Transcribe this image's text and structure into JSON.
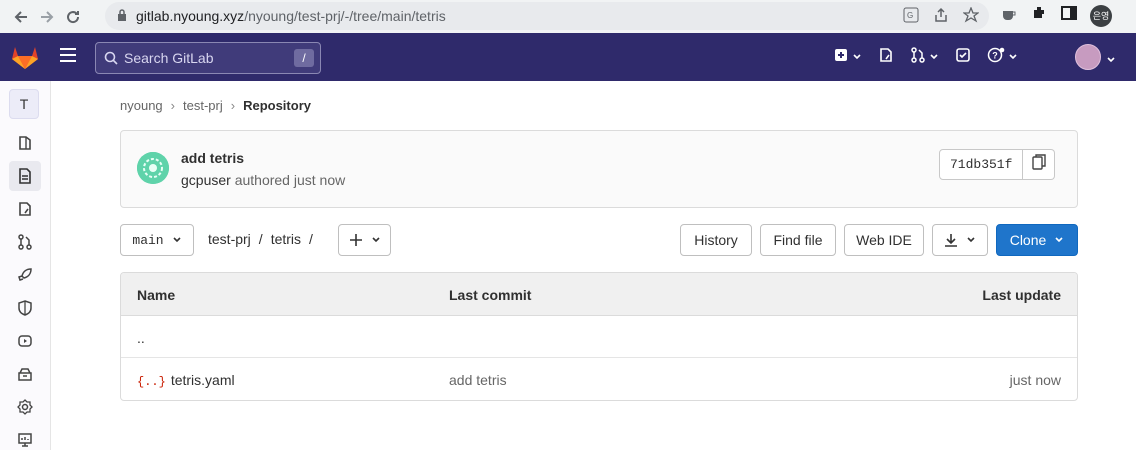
{
  "browser": {
    "url_host": "gitlab.nyoung.xyz",
    "url_path": "/nyoung/test-prj/-/tree/main/tetris",
    "profile_label": "은영"
  },
  "header": {
    "search_placeholder": "Search GitLab",
    "search_shortcut": "/"
  },
  "sidebar": {
    "project_initial": "T",
    "items": [
      "project-overview-icon",
      "repository-icon",
      "issues-icon",
      "merge-requests-icon",
      "deployments-icon",
      "security-icon",
      "pipelines-icon",
      "packages-icon",
      "settings-icon",
      "monitor-icon"
    ]
  },
  "breadcrumb": {
    "items": [
      "nyoung",
      "test-prj"
    ],
    "current": "Repository"
  },
  "commit": {
    "title": "add tetris",
    "author": "gcpuser",
    "meta_suffix": "authored just now",
    "sha": "71db351f"
  },
  "toolbar": {
    "branch": "main",
    "path": [
      "test-prj",
      "tetris"
    ],
    "history": "History",
    "find_file": "Find file",
    "web_ide": "Web IDE",
    "clone": "Clone"
  },
  "tree": {
    "headers": {
      "name": "Name",
      "last_commit": "Last commit",
      "last_update": "Last update"
    },
    "parent": "..",
    "rows": [
      {
        "name": "tetris.yaml",
        "commit": "add tetris",
        "updated": "just now"
      }
    ]
  },
  "colors": {
    "header": "#2f2a6b",
    "primary": "#1f75cb"
  }
}
